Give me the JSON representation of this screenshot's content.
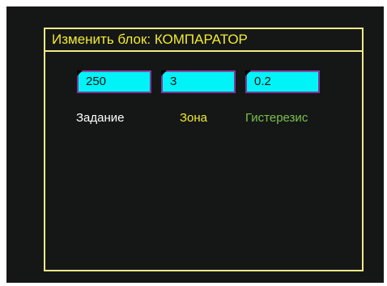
{
  "dialog": {
    "title": "Изменить блок:  КОМПАРАТОР"
  },
  "fields": [
    {
      "value": "250",
      "label": "Задание",
      "label_color": "#ffffff"
    },
    {
      "value": "3",
      "label": "Зона",
      "label_color": "#f1ea31"
    },
    {
      "value": "0.2",
      "label": "Гистерезис",
      "label_color": "#7cc04a"
    }
  ]
}
